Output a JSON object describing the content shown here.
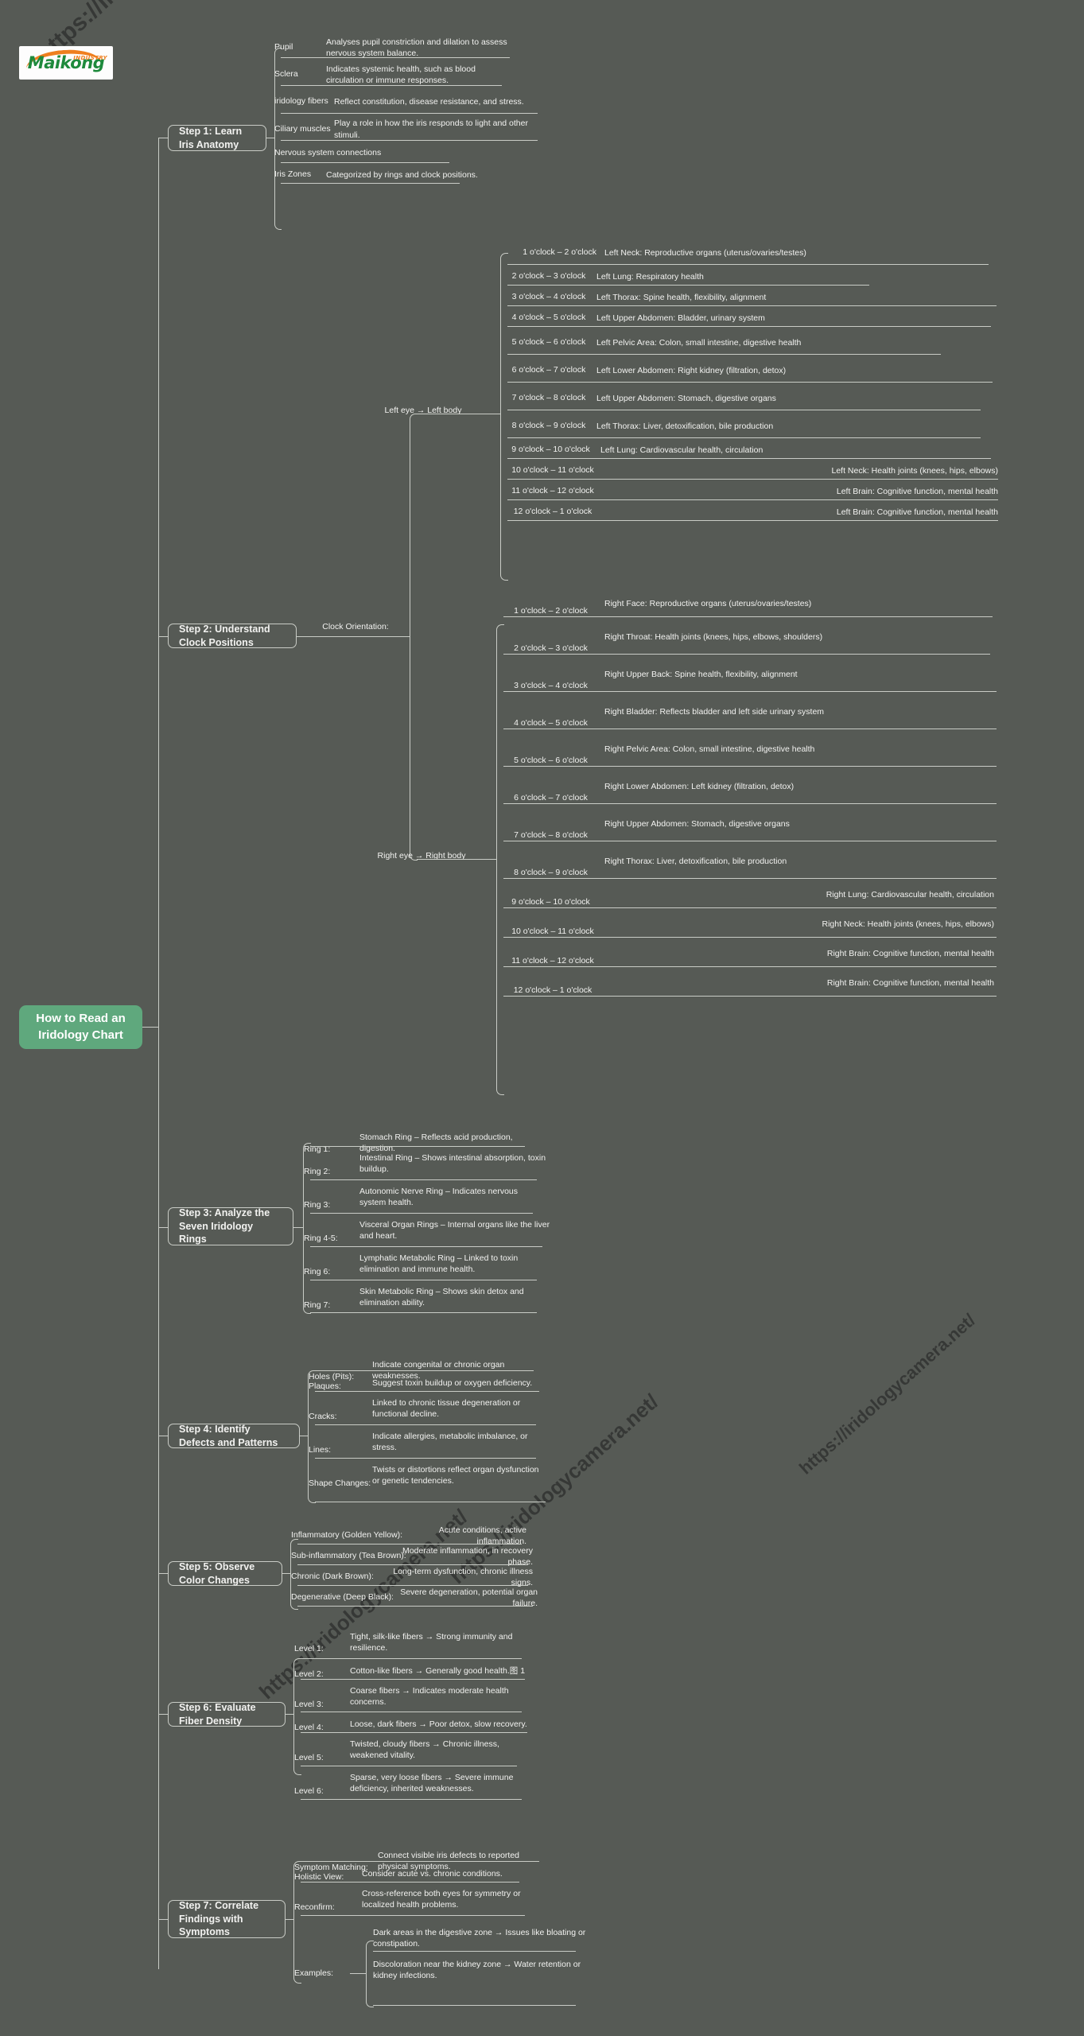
{
  "watermarks": {
    "w1": "https://iridologycamera.net/",
    "w2": "https://iridologycamera.net/",
    "w3": "https://iridologycamera.net/",
    "w4": "https://iridologycamera.net/"
  },
  "logo": {
    "brand": "Maikong",
    "tagline": "INDUSTRY"
  },
  "root": {
    "title": "How to Read an Iridology Chart",
    "color": "#5fa87d"
  },
  "steps": [
    {
      "label": "Step 1: Learn Iris Anatomy"
    },
    {
      "label": "Step 2: Understand Clock Positions"
    },
    {
      "label": "Step 3: Analyze the Seven Iridology Rings"
    },
    {
      "label": "Step 4: Identify Defects and Patterns"
    },
    {
      "label": "Step 5: Observe Color Changes"
    },
    {
      "label": "Step 6: Evaluate Fiber Density"
    },
    {
      "label": "Step 7: Correlate Findings with Symptoms"
    }
  ],
  "step1": {
    "items": [
      {
        "key": "Pupil",
        "val": "Analyses pupil constriction and dilation to assess nervous system balance."
      },
      {
        "key": "Sclera",
        "val": "Indicates systemic health, such as blood circulation or immune responses."
      },
      {
        "key": "iridology fibers",
        "val": "Reflect constitution, disease resistance, and stress."
      },
      {
        "key": "Ciliary muscles",
        "val": "Play a role in how the iris responds to light and other stimuli."
      },
      {
        "key": "Nervous system connections",
        "val": ""
      },
      {
        "key": "Iris Zones",
        "val": "Categorized by rings and clock positions."
      }
    ]
  },
  "step2": {
    "orientation_label": "Clock Orientation:",
    "left_label": "Left eye → Left body",
    "right_label": "Right eye → Right body",
    "left_eye": [
      {
        "key": "1 o'clock – 2 o'clock",
        "val": "Left Neck: Reproductive organs (uterus/ovaries/testes)"
      },
      {
        "key": "2 o'clock – 3 o'clock",
        "val": "Left Lung: Respiratory health"
      },
      {
        "key": "3 o'clock – 4 o'clock",
        "val": "Left Thorax: Spine health, flexibility, alignment"
      },
      {
        "key": "4 o'clock – 5 o'clock",
        "val": "Left Upper Abdomen: Bladder, urinary system"
      },
      {
        "key": "5 o'clock – 6 o'clock",
        "val": "Left Pelvic Area: Colon, small intestine, digestive health"
      },
      {
        "key": "6 o'clock – 7 o'clock",
        "val": "Left Lower Abdomen: Right kidney (filtration, detox)"
      },
      {
        "key": "7 o'clock – 8 o'clock",
        "val": "Left Upper Abdomen: Stomach, digestive organs"
      },
      {
        "key": "8 o'clock – 9 o'clock",
        "val": "Left Thorax: Liver, detoxification, bile production"
      },
      {
        "key": "9 o'clock – 10 o'clock",
        "val": "Left Lung: Cardiovascular health, circulation"
      },
      {
        "key": "10 o'clock – 11 o'clock",
        "val": "Left Neck: Health joints (knees, hips, elbows)"
      },
      {
        "key": "11 o'clock – 12 o'clock",
        "val": "Left Brain: Cognitive function, mental health"
      },
      {
        "key": "12 o'clock – 1 o'clock",
        "val": "Left Brain: Cognitive function, mental health"
      }
    ],
    "right_eye": [
      {
        "key": "1 o'clock – 2 o'clock",
        "val": "Right Face: Reproductive organs (uterus/ovaries/testes)"
      },
      {
        "key": "2 o'clock – 3 o'clock",
        "val": "Right Throat: Health joints (knees, hips, elbows, shoulders)"
      },
      {
        "key": "3 o'clock – 4 o'clock",
        "val": "Right Upper Back: Spine health, flexibility, alignment"
      },
      {
        "key": "4 o'clock – 5 o'clock",
        "val": "Right Bladder: Reflects bladder and left side urinary system"
      },
      {
        "key": "5 o'clock – 6 o'clock",
        "val": "Right Pelvic Area: Colon, small intestine, digestive health"
      },
      {
        "key": "6 o'clock – 7 o'clock",
        "val": "Right Lower Abdomen: Left kidney (filtration, detox)"
      },
      {
        "key": "7 o'clock – 8 o'clock",
        "val": "Right Upper Abdomen: Stomach, digestive organs"
      },
      {
        "key": "8 o'clock – 9 o'clock",
        "val": "Right Thorax: Liver, detoxification, bile production"
      },
      {
        "key": "9 o'clock – 10 o'clock",
        "val": "Right Lung: Cardiovascular health, circulation"
      },
      {
        "key": "10 o'clock – 11 o'clock",
        "val": "Right Neck: Health joints (knees, hips, elbows)"
      },
      {
        "key": "11 o'clock – 12 o'clock",
        "val": "Right Brain: Cognitive function, mental health"
      },
      {
        "key": "12 o'clock – 1 o'clock",
        "val": "Right Brain: Cognitive function, mental health"
      }
    ]
  },
  "step3": {
    "items": [
      {
        "key": "Ring 1:",
        "val": "Stomach Ring – Reflects acid production, digestion."
      },
      {
        "key": "Ring 2:",
        "val": "Intestinal Ring – Shows intestinal absorption, toxin buildup."
      },
      {
        "key": "Ring 3:",
        "val": "Autonomic Nerve Ring – Indicates nervous system health."
      },
      {
        "key": "Ring 4-5:",
        "val": "Visceral Organ Rings – Internal organs like the liver and heart."
      },
      {
        "key": "Ring 6:",
        "val": "Lymphatic Metabolic Ring – Linked to toxin elimination and immune health."
      },
      {
        "key": "Ring 7:",
        "val": "Skin Metabolic Ring – Shows skin detox and elimination ability."
      }
    ]
  },
  "step4": {
    "items": [
      {
        "key": "Holes (Pits):",
        "val": "Indicate congenital or chronic organ weaknesses."
      },
      {
        "key": "Plaques:",
        "val": "Suggest toxin buildup or oxygen deficiency."
      },
      {
        "key": "Cracks:",
        "val": "Linked to chronic tissue degeneration or functional decline."
      },
      {
        "key": "Lines:",
        "val": "Indicate allergies, metabolic imbalance, or stress."
      },
      {
        "key": "Shape Changes:",
        "val": "Twists or distortions reflect organ dysfunction or genetic tendencies."
      }
    ]
  },
  "step5": {
    "items": [
      {
        "key": "Inflammatory (Golden Yellow):",
        "val": "Acute conditions, active inflammation."
      },
      {
        "key": "Sub-inflammatory (Tea Brown):",
        "val": "Moderate inflammation, in recovery phase."
      },
      {
        "key": "Chronic (Dark Brown):",
        "val": "Long-term dysfunction, chronic illness signs."
      },
      {
        "key": "Degenerative (Deep Black):",
        "val": "Severe degeneration, potential organ failure."
      }
    ]
  },
  "step6": {
    "items": [
      {
        "key": "Level 1:",
        "val": "Tight, silk-like fibers → Strong immunity and resilience."
      },
      {
        "key": "Level 2:",
        "val": "Cotton-like fibers → Generally good health.图 1"
      },
      {
        "key": "Level 3:",
        "val": "Coarse fibers → Indicates moderate health concerns."
      },
      {
        "key": "Level 4:",
        "val": "Loose, dark fibers → Poor detox, slow recovery."
      },
      {
        "key": "Level 5:",
        "val": "Twisted, cloudy fibers → Chronic illness, weakened vitality."
      },
      {
        "key": "Level 6:",
        "val": "Sparse, very loose fibers → Severe immune deficiency, inherited weaknesses."
      }
    ]
  },
  "step7": {
    "items": [
      {
        "key": "Symptom Matching:",
        "val": "Connect visible iris defects to reported physical symptoms."
      },
      {
        "key": "Holistic View:",
        "val": "Consider acute vs. chronic conditions."
      },
      {
        "key": "Reconfirm:",
        "val": "Cross-reference both eyes for symmetry or localized health problems."
      },
      {
        "key": "Examples:",
        "val": ""
      }
    ],
    "examples": [
      "Dark areas in the digestive zone → Issues like bloating or constipation.",
      "Discoloration near the kidney zone → Water retention or kidney infections."
    ]
  }
}
